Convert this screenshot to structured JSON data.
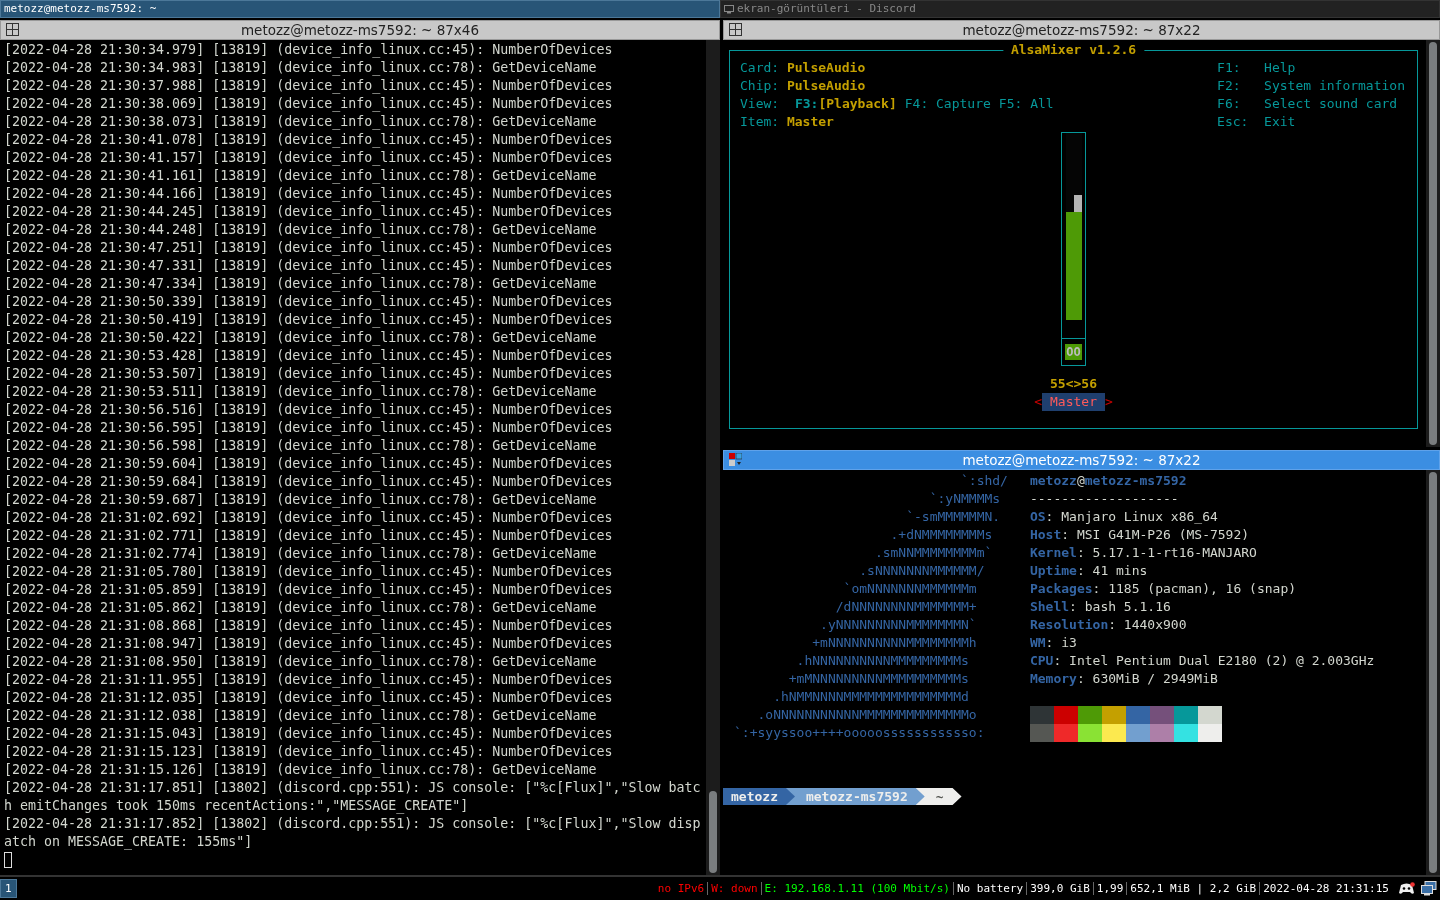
{
  "top_tabs": [
    {
      "title": "metozz@metozz-ms7592: ~",
      "selected": true
    },
    {
      "title": "ekran-görüntüleri - Discord",
      "selected": false
    }
  ],
  "log_window": {
    "title": "metozz@metozz-ms7592: ~ 87x46",
    "focused": false,
    "lines": [
      "[2022-04-28 21:30:34.979] [13819] (device_info_linux.cc:45): NumberOfDevices",
      "[2022-04-28 21:30:34.983] [13819] (device_info_linux.cc:78): GetDeviceName",
      "[2022-04-28 21:30:37.988] [13819] (device_info_linux.cc:45): NumberOfDevices",
      "[2022-04-28 21:30:38.069] [13819] (device_info_linux.cc:45): NumberOfDevices",
      "[2022-04-28 21:30:38.073] [13819] (device_info_linux.cc:78): GetDeviceName",
      "[2022-04-28 21:30:41.078] [13819] (device_info_linux.cc:45): NumberOfDevices",
      "[2022-04-28 21:30:41.157] [13819] (device_info_linux.cc:45): NumberOfDevices",
      "[2022-04-28 21:30:41.161] [13819] (device_info_linux.cc:78): GetDeviceName",
      "[2022-04-28 21:30:44.166] [13819] (device_info_linux.cc:45): NumberOfDevices",
      "[2022-04-28 21:30:44.245] [13819] (device_info_linux.cc:45): NumberOfDevices",
      "[2022-04-28 21:30:44.248] [13819] (device_info_linux.cc:78): GetDeviceName",
      "[2022-04-28 21:30:47.251] [13819] (device_info_linux.cc:45): NumberOfDevices",
      "[2022-04-28 21:30:47.331] [13819] (device_info_linux.cc:45): NumberOfDevices",
      "[2022-04-28 21:30:47.334] [13819] (device_info_linux.cc:78): GetDeviceName",
      "[2022-04-28 21:30:50.339] [13819] (device_info_linux.cc:45): NumberOfDevices",
      "[2022-04-28 21:30:50.419] [13819] (device_info_linux.cc:45): NumberOfDevices",
      "[2022-04-28 21:30:50.422] [13819] (device_info_linux.cc:78): GetDeviceName",
      "[2022-04-28 21:30:53.428] [13819] (device_info_linux.cc:45): NumberOfDevices",
      "[2022-04-28 21:30:53.507] [13819] (device_info_linux.cc:45): NumberOfDevices",
      "[2022-04-28 21:30:53.511] [13819] (device_info_linux.cc:78): GetDeviceName",
      "[2022-04-28 21:30:56.516] [13819] (device_info_linux.cc:45): NumberOfDevices",
      "[2022-04-28 21:30:56.595] [13819] (device_info_linux.cc:45): NumberOfDevices",
      "[2022-04-28 21:30:56.598] [13819] (device_info_linux.cc:78): GetDeviceName",
      "[2022-04-28 21:30:59.604] [13819] (device_info_linux.cc:45): NumberOfDevices",
      "[2022-04-28 21:30:59.684] [13819] (device_info_linux.cc:45): NumberOfDevices",
      "[2022-04-28 21:30:59.687] [13819] (device_info_linux.cc:78): GetDeviceName",
      "[2022-04-28 21:31:02.692] [13819] (device_info_linux.cc:45): NumberOfDevices",
      "[2022-04-28 21:31:02.771] [13819] (device_info_linux.cc:45): NumberOfDevices",
      "[2022-04-28 21:31:02.774] [13819] (device_info_linux.cc:78): GetDeviceName",
      "[2022-04-28 21:31:05.780] [13819] (device_info_linux.cc:45): NumberOfDevices",
      "[2022-04-28 21:31:05.859] [13819] (device_info_linux.cc:45): NumberOfDevices",
      "[2022-04-28 21:31:05.862] [13819] (device_info_linux.cc:78): GetDeviceName",
      "[2022-04-28 21:31:08.868] [13819] (device_info_linux.cc:45): NumberOfDevices",
      "[2022-04-28 21:31:08.947] [13819] (device_info_linux.cc:45): NumberOfDevices",
      "[2022-04-28 21:31:08.950] [13819] (device_info_linux.cc:78): GetDeviceName",
      "[2022-04-28 21:31:11.955] [13819] (device_info_linux.cc:45): NumberOfDevices",
      "[2022-04-28 21:31:12.035] [13819] (device_info_linux.cc:45): NumberOfDevices",
      "[2022-04-28 21:31:12.038] [13819] (device_info_linux.cc:78): GetDeviceName",
      "[2022-04-28 21:31:15.043] [13819] (device_info_linux.cc:45): NumberOfDevices",
      "[2022-04-28 21:31:15.123] [13819] (device_info_linux.cc:45): NumberOfDevices",
      "[2022-04-28 21:31:15.126] [13819] (device_info_linux.cc:78): GetDeviceName",
      "[2022-04-28 21:31:17.851] [13802] (discord.cpp:551): JS console: [\"%c[Flux]\",\"Slow batch emitChanges took 150ms recentActions:\",\"MESSAGE_CREATE\"]",
      "[2022-04-28 21:31:17.852] [13802] (discord.cpp:551): JS console: [\"%c[Flux]\",\"Slow dispatch on MESSAGE_CREATE: 155ms\"]"
    ]
  },
  "mixer_window": {
    "title": "metozz@metozz-ms7592: ~ 87x22",
    "focused": false,
    "app_title": "AlsaMixer v1.2.6",
    "info": [
      {
        "label": "Card:",
        "value": "PulseAudio"
      },
      {
        "label": "Chip:",
        "value": "PulseAudio"
      }
    ],
    "view_label": "View:",
    "views": [
      {
        "key": "F3:",
        "label": "[Playback]",
        "selected": true
      },
      {
        "key": "F4:",
        "label": "Capture",
        "selected": false
      },
      {
        "key": "F5:",
        "label": "All",
        "selected": false
      }
    ],
    "item_label": "Item:",
    "item_value": "Master",
    "help": [
      {
        "key": "F1:",
        "label": "Help"
      },
      {
        "key": "F2:",
        "label": "System information"
      },
      {
        "key": "F6:",
        "label": "Select sound card"
      },
      {
        "key": "Esc:",
        "label": "Exit"
      }
    ],
    "channel": {
      "level": 0.58,
      "mute_text": "OO",
      "reading": "55<>56",
      "left_arrow": "<",
      "name": "Master",
      "right_arrow": ">",
      "selected": true
    }
  },
  "info_window": {
    "title": "metozz@metozz-ms7592: ~ 87x22",
    "focused": true,
    "logo": [
      "                             `:shd/",
      "                         `:yNMMMMs",
      "                      `-smMMMMMMN.",
      "                    .+dNMMMMMMMMs",
      "                  .smNNMMMMMMMMm`",
      "                .sNNNNNNNMMMMMM/",
      "              `omNNNNNNNMMMMMMm",
      "             /dNNNNNNNNMMMMMMM+",
      "           .yNNNNNNNNNMMMMMMMN`",
      "          +mNNNNNNNNNNMMMMMMMMh",
      "        .hNNNNNNNNNNMMMMMMMMMs",
      "       +mMNNNNNNNNNMMMMMMMMMMs",
      "     .hNMMNNNNMMMMMMMMMMMMMMMd",
      "   .oNNNNNNNNNNNMMMMMMMMMMMMMMo",
      "`:+syyssoo++++ooooossssssssssso:"
    ],
    "user": "metozz",
    "at": "@",
    "host": "metozz-ms7592",
    "rule": "-------------------",
    "info": [
      {
        "key": "OS",
        "value": "Manjaro Linux x86_64"
      },
      {
        "key": "Host",
        "value": "MSI G41M-P26 (MS-7592)"
      },
      {
        "key": "Kernel",
        "value": "5.17.1-1-rt16-MANJARO"
      },
      {
        "key": "Uptime",
        "value": "41 mins"
      },
      {
        "key": "Packages",
        "value": "1185 (pacman), 16 (snap)"
      },
      {
        "key": "Shell",
        "value": "bash 5.1.16"
      },
      {
        "key": "Resolution",
        "value": "1440x900"
      },
      {
        "key": "WM",
        "value": "i3"
      },
      {
        "key": "CPU",
        "value": "Intel Pentium Dual E2180 (2) @ 2.003GHz"
      },
      {
        "key": "Memory",
        "value": "630MiB / 2949MiB"
      }
    ],
    "colon": ":",
    "palette": [
      {
        "color": "#2e3436"
      },
      {
        "color": "#cc0000"
      },
      {
        "color": "#4e9a06"
      },
      {
        "color": "#c4a000"
      },
      {
        "color": "#3465a4"
      },
      {
        "color": "#75507b"
      },
      {
        "color": "#06989a"
      },
      {
        "color": "#d3d7cf"
      },
      {
        "color": "#555753"
      },
      {
        "color": "#ef2929"
      },
      {
        "color": "#8ae234"
      },
      {
        "color": "#fce94f"
      },
      {
        "color": "#729fcf"
      },
      {
        "color": "#ad7fa8"
      },
      {
        "color": "#34e2e2"
      },
      {
        "color": "#eeeeec"
      }
    ],
    "prompt": [
      {
        "kind": "user",
        "text": "metozz"
      },
      {
        "kind": "host",
        "text": "metozz-ms7592"
      },
      {
        "kind": "cwd",
        "text": "~"
      }
    ]
  },
  "status_bar": {
    "workspaces": [
      {
        "label": "1",
        "selected": true
      }
    ],
    "items": [
      {
        "text": "no IPv6",
        "color": "#ff0000"
      },
      {
        "text": "W: down",
        "color": "#ff0000"
      },
      {
        "text": "E: 192.168.1.11 (100 Mbit/s)",
        "color": "#00ff00"
      },
      {
        "text": "No battery",
        "color": "#ffffff"
      },
      {
        "text": "399,0 GiB",
        "color": "#ffffff"
      },
      {
        "text": "1,99",
        "color": "#ffffff"
      },
      {
        "text": "652,1 MiB | 2,2 GiB",
        "color": "#ffffff"
      },
      {
        "text": "2022-04-28 21:31:15",
        "color": "#ffffff"
      }
    ]
  }
}
